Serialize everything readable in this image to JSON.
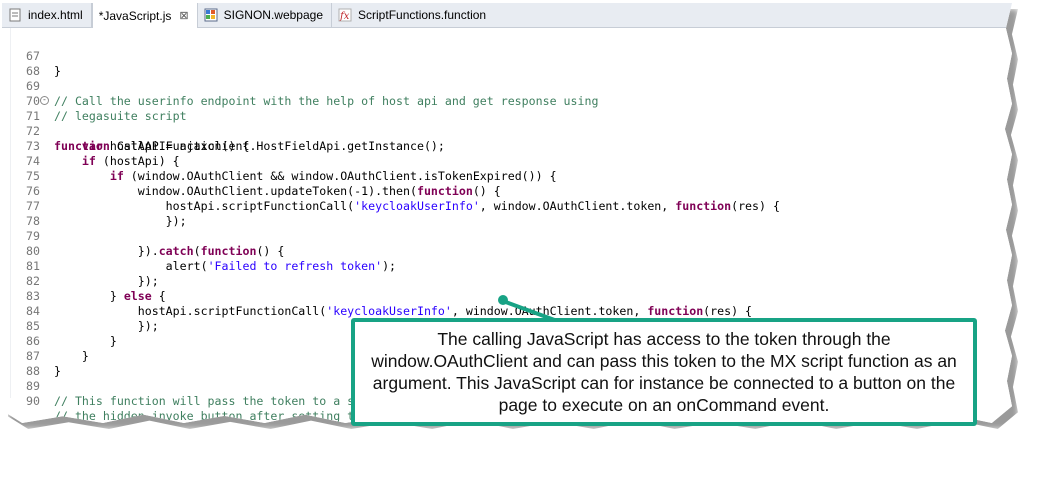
{
  "tabs": [
    {
      "label": "index.html",
      "icon": "html-file-icon",
      "active": false
    },
    {
      "label": "*JavaScript.js",
      "icon": "js-file-icon",
      "active": true,
      "close": "⊠"
    },
    {
      "label": "SIGNON.webpage",
      "icon": "webpage-file-icon",
      "active": false
    },
    {
      "label": "ScriptFunctions.function",
      "icon": "function-file-icon",
      "active": false
    }
  ],
  "code_lines": [
    {
      "n": "67",
      "text": "}"
    },
    {
      "n": "68",
      "text": ""
    },
    {
      "n": "69",
      "text": "// Call the userinfo endpoint with the help of host api and get response using"
    },
    {
      "n": "70",
      "text": "// legasuite script"
    },
    {
      "n": "71",
      "text": "function CallAPIFunction() {"
    },
    {
      "n": "72",
      "text": "    var hostApi = ajaxclient.HostFieldApi.getInstance();"
    },
    {
      "n": "73",
      "text": "    if (hostApi) {"
    },
    {
      "n": "74",
      "text": "        if (window.OAuthClient && window.OAuthClient.isTokenExpired()) {"
    },
    {
      "n": "75",
      "text": "            window.OAuthClient.updateToken(-1).then(function() {"
    },
    {
      "n": "76",
      "text": "                hostApi.scriptFunctionCall('keycloakUserInfo', window.OAuthClient.token, function(res) {"
    },
    {
      "n": "77",
      "text": "                });"
    },
    {
      "n": "78",
      "text": ""
    },
    {
      "n": "79",
      "text": "            }).catch(function() {"
    },
    {
      "n": "80",
      "text": "                alert('Failed to refresh token');"
    },
    {
      "n": "81",
      "text": "            });"
    },
    {
      "n": "82",
      "text": "        } else {"
    },
    {
      "n": "83",
      "text": "            hostApi.scriptFunctionCall('keycloakUserInfo', window.OAuthClient.token, function(res) {"
    },
    {
      "n": "84",
      "text": "            });"
    },
    {
      "n": "85",
      "text": "        }"
    },
    {
      "n": "86",
      "text": "    }"
    },
    {
      "n": "87",
      "text": "}"
    },
    {
      "n": "88",
      "text": ""
    },
    {
      "n": "89",
      "text": "// This function will pass the token to a s"
    },
    {
      "n": "90",
      "text": "// the hidden invoke button after setting t"
    }
  ],
  "callout": {
    "text": "The calling JavaScript has access to the token through the window.OAuthClient and can pass this token to the MX script function as an argument. This JavaScript can for instance be connected to a button on the page to execute on an onCommand event."
  },
  "colors": {
    "callout_border": "#18a385",
    "keyword": "#7f0055",
    "string": "#2a00ff",
    "comment": "#3f7f5f"
  }
}
